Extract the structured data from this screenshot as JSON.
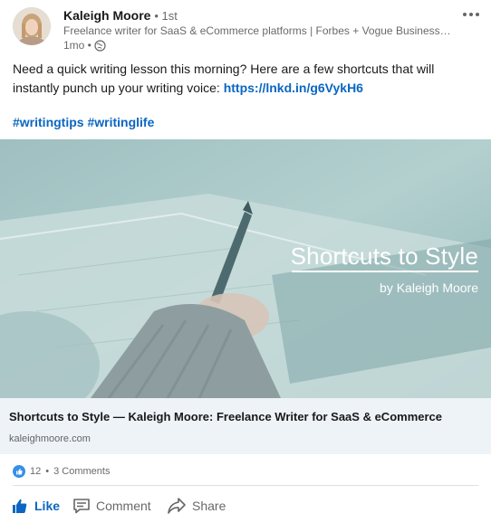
{
  "author": {
    "name": "Kaleigh Moore",
    "degree": "• 1st",
    "headline": "Freelance writer for SaaS & eCommerce platforms | Forbes + Vogue Business r...",
    "time": "1mo •"
  },
  "post": {
    "text": "Need a quick writing lesson this morning? Here are a few shortcuts that will instantly punch up your writing voice: ",
    "link": "https://lnkd.in/g6VykH6",
    "hashtags": [
      "#writingtips",
      "#writinglife"
    ]
  },
  "image": {
    "title": "Shortcuts to Style",
    "byline": "by Kaleigh Moore"
  },
  "preview": {
    "title": "Shortcuts to Style — Kaleigh Moore: Freelance Writer for SaaS & eCommerce",
    "domain": "kaleighmoore.com"
  },
  "social": {
    "reactions": "12",
    "separator": "•",
    "comments": "3 Comments"
  },
  "actions": {
    "like": "Like",
    "comment": "Comment",
    "share": "Share"
  },
  "colors": {
    "link": "#0a66c2",
    "image_tint": "#a9c7c8",
    "preview_bg": "#eef3f8"
  },
  "icons": {
    "visibility": "globe-icon",
    "more": "more-horizontal-icon",
    "reaction": "like-reaction-icon",
    "like": "thumbs-up-icon",
    "comment": "comment-icon",
    "share": "share-arrow-icon"
  }
}
